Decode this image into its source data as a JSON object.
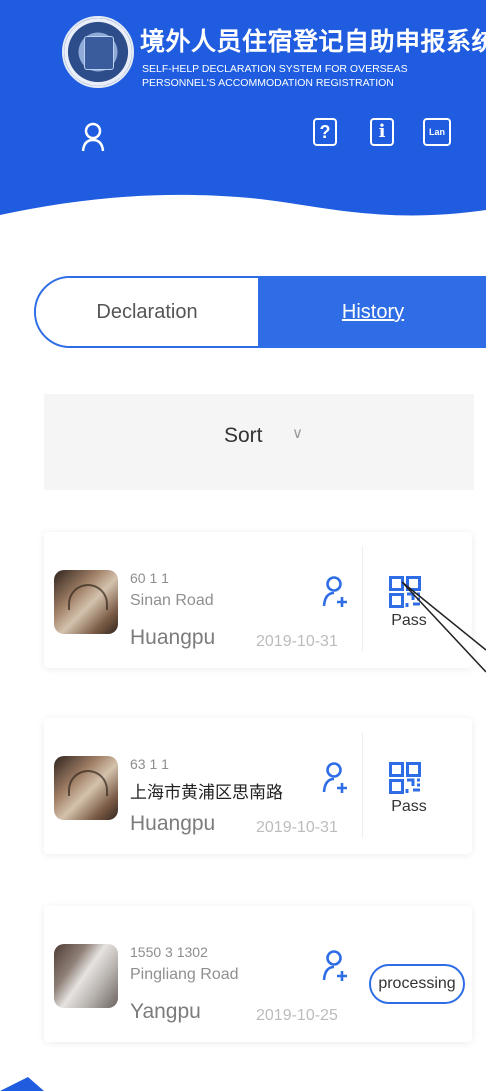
{
  "header": {
    "title_cn": "境外人员住宿登记自助申报系统",
    "title_en": "SELF-HELP DECLARATION SYSTEM FOR OVERSEAS PERSONNEL'S ACCOMMODATION REGISTRATION",
    "help_label": "?",
    "info_label": "i",
    "lan_label": "Lan",
    "icons": [
      "emblem-logo",
      "user-icon",
      "help-icon",
      "info-icon",
      "language-icon"
    ],
    "colors": {
      "brand": "#1f5ce0",
      "accent": "#2f6de6"
    }
  },
  "tabs": [
    {
      "label": "Declaration",
      "active": false
    },
    {
      "label": "History",
      "active": true
    }
  ],
  "sort": {
    "label": "Sort",
    "chevron": "∨"
  },
  "records": [
    {
      "line1": "60 1 1",
      "line2": "Sinan Road",
      "district": "Huangpu",
      "date": "2019-10-31",
      "status": "Pass"
    },
    {
      "line1": "63 1 1",
      "line2": "上海市黄浦区思南路",
      "district": "Huangpu",
      "date": "2019-10-31",
      "status": "Pass"
    },
    {
      "line1": "1550 3 1302",
      "line2": "Pingliang Road",
      "district": "Yangpu",
      "date": "2019-10-25",
      "status": "processing"
    }
  ]
}
